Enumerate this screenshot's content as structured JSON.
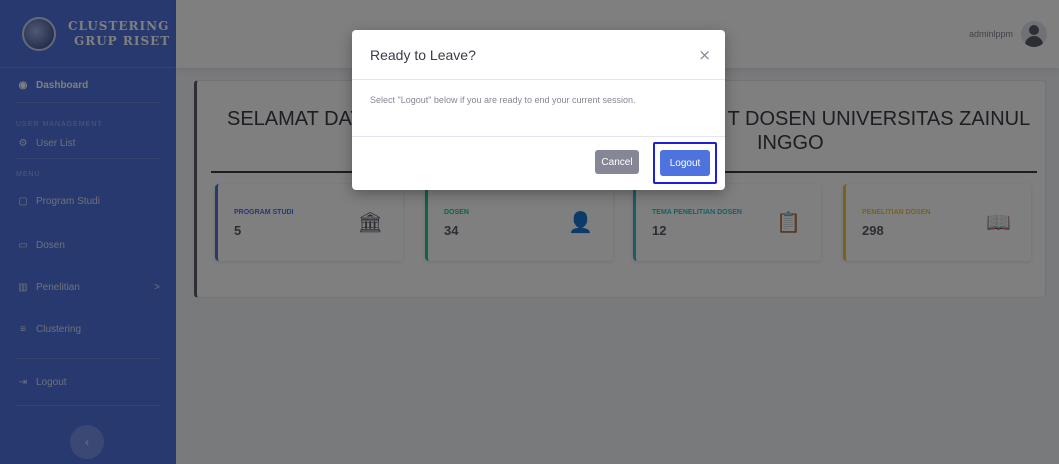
{
  "brand": {
    "line1": "CLUSTERING",
    "line2": "GRUP RISET"
  },
  "sidebar": {
    "dashboard": {
      "icon": "dashboard-icon",
      "label": "Dashboard"
    },
    "heading_user": "USER MANAGEMENT",
    "user_list": {
      "icon": "user-icon",
      "label": "User List"
    },
    "heading_menu": "MENU",
    "items": [
      {
        "icon": "clipboard-icon",
        "label": "Program Studi"
      },
      {
        "icon": "folder-icon",
        "label": "Dosen"
      },
      {
        "icon": "chart-icon",
        "label": "Penelitian",
        "chevron": ">"
      },
      {
        "icon": "cluster-icon",
        "label": "Clustering"
      }
    ],
    "logout": {
      "icon": "signout-icon",
      "label": "Logout"
    },
    "toggle_glyph": "‹"
  },
  "topbar": {
    "username": "adminlppm"
  },
  "main": {
    "welcome_part1": "SELAMAT DAT",
    "welcome_part2": "T DOSEN UNIVERSITAS ZAINUL",
    "welcome_line2": "INGGO"
  },
  "stats": [
    {
      "label": "PROGRAM STUDI",
      "value": "5",
      "icon": "university-icon",
      "glyph": "🏛",
      "color": "#4e73df"
    },
    {
      "label": "DOSEN",
      "value": "34",
      "icon": "user-tie-icon",
      "glyph": "👤",
      "color": "#1cc88a"
    },
    {
      "label": "TEMA PENELITIAN DOSEN",
      "value": "12",
      "icon": "clipboard-list-icon",
      "glyph": "📋",
      "color": "#36b9cc"
    },
    {
      "label": "PENELITIAN DOSEN",
      "value": "298",
      "icon": "book-open-icon",
      "glyph": "📖",
      "color": "#f6c23e"
    }
  ],
  "modal": {
    "title": "Ready to Leave?",
    "close": "×",
    "body": "Select \"Logout\" below if you are ready to end your current session.",
    "cancel": "Cancel",
    "logout": "Logout"
  }
}
